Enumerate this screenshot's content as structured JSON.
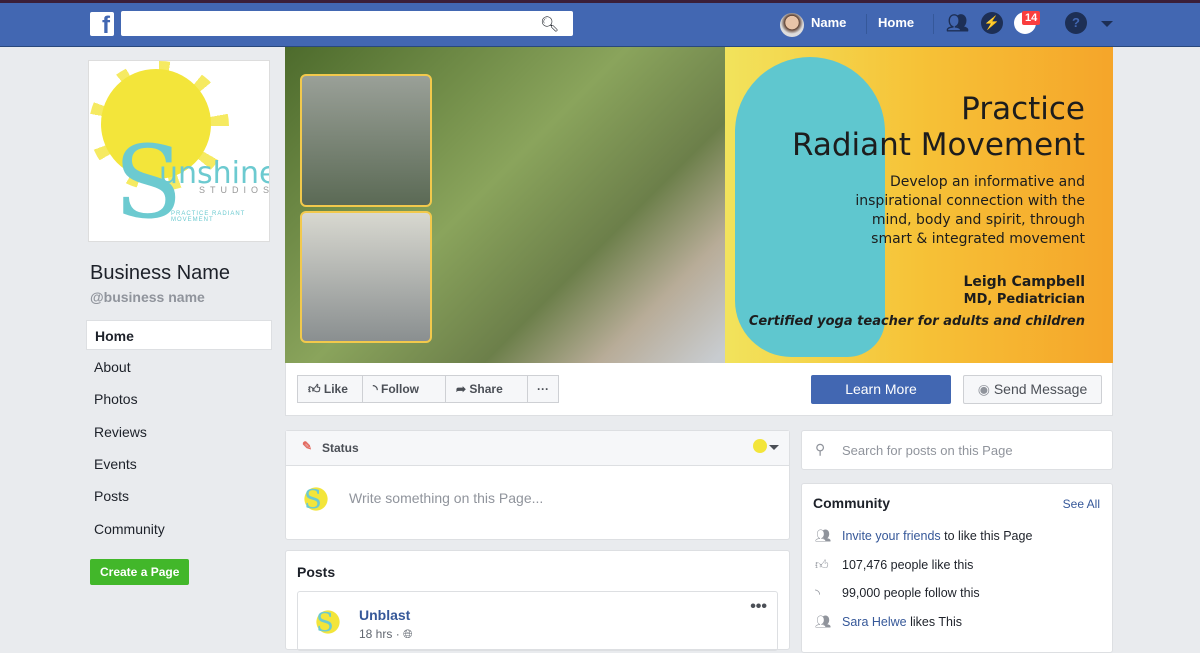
{
  "topbar": {
    "search_placeholder": "",
    "user_name": "Name",
    "home": "Home",
    "notifications_count": "14"
  },
  "page": {
    "name": "Business Name",
    "handle": "@business name",
    "logo": {
      "word": "unshine",
      "sub": "STUDIOS",
      "tagline": "PRACTICE RADIANT MOVEMENT"
    }
  },
  "nav": [
    "Home",
    "About",
    "Photos",
    "Reviews",
    "Events",
    "Posts",
    "Community"
  ],
  "create_page": "Create a Page",
  "cover": {
    "title1": "Practice",
    "title2": "Radiant Movement",
    "desc": [
      "Develop an informative and",
      "inspirational connection with the",
      "mind, body and spirit, through",
      "smart & integrated movement"
    ],
    "name": "Leigh Campbell",
    "credential": "MD, Pediatrician",
    "tagline": "Certified yoga teacher for adults and children"
  },
  "actions": {
    "like": "Like",
    "follow": "Follow",
    "share": "Share",
    "more": "···",
    "learn_more": "Learn More",
    "send_message": "Send Message"
  },
  "status": {
    "label": "Status",
    "placeholder": "Write something on this Page..."
  },
  "posts": {
    "title": "Posts",
    "author": "Unblast",
    "time": "18 hrs"
  },
  "right": {
    "search_placeholder": "Search for posts on this Page",
    "community": {
      "title": "Community",
      "see_all": "See All",
      "invite_link": "Invite your friends",
      "invite_rest": " to like this Page",
      "likes": "107,476 people like this",
      "follows": "99,000 people follow this",
      "friend": "Sara Helwe",
      "friend_rest": " likes This"
    }
  },
  "colors": {
    "brand": "#4267b2",
    "link": "#365899",
    "cta_green": "#42b72a"
  }
}
